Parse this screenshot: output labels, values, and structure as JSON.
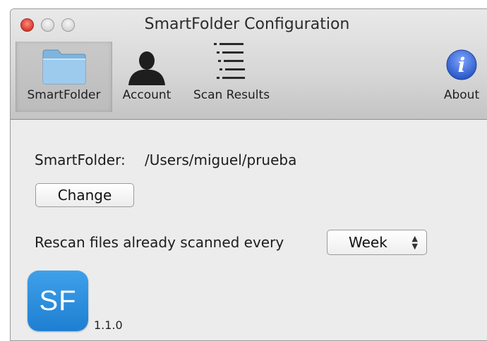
{
  "window": {
    "title": "SmartFolder Configuration"
  },
  "toolbar": {
    "items": [
      {
        "label": "SmartFolder",
        "icon": "folder-icon",
        "selected": true
      },
      {
        "label": "Account",
        "icon": "user-icon",
        "selected": false
      },
      {
        "label": "Scan Results",
        "icon": "list-icon",
        "selected": false
      },
      {
        "label": "About",
        "icon": "info-icon",
        "selected": false
      }
    ]
  },
  "main": {
    "smartfolder_label": "SmartFolder:",
    "smartfolder_path": "/Users/miguel/prueba",
    "change_button": "Change",
    "rescan_label": "Rescan files already scanned every",
    "rescan_value": "Week",
    "app_icon_text": "SF",
    "version": "1.1.0"
  },
  "colors": {
    "about_icon": "#3d6fd8",
    "app_icon": "#2a8ce0",
    "close_button": "#e24a3c"
  }
}
